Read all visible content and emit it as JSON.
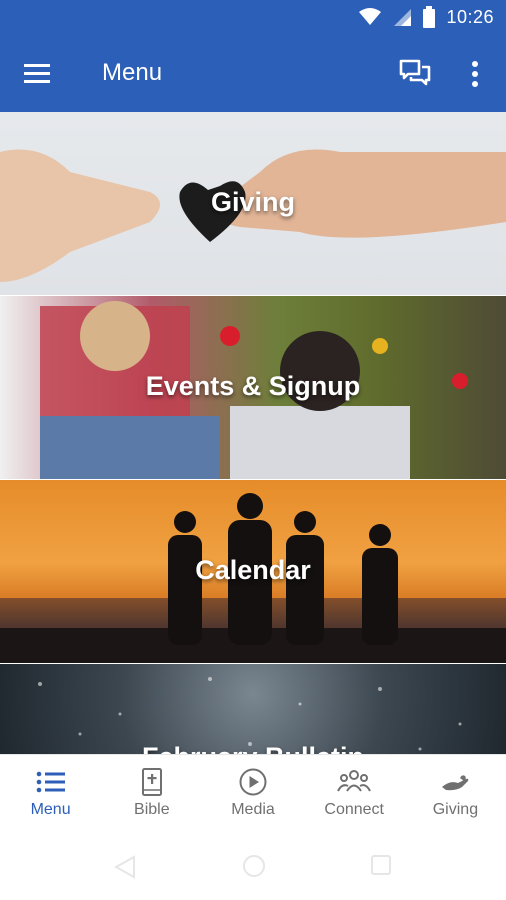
{
  "status_bar": {
    "time": "10:26"
  },
  "app_bar": {
    "title": "Menu"
  },
  "tiles": [
    {
      "label": "Giving"
    },
    {
      "label": "Events & Signup"
    },
    {
      "label": "Calendar"
    },
    {
      "label": "February Bulletin"
    }
  ],
  "bottom_nav": {
    "items": [
      {
        "label": "Menu",
        "icon": "list-icon",
        "active": true
      },
      {
        "label": "Bible",
        "icon": "bible-icon",
        "active": false
      },
      {
        "label": "Media",
        "icon": "play-icon",
        "active": false
      },
      {
        "label": "Connect",
        "icon": "people-icon",
        "active": false
      },
      {
        "label": "Giving",
        "icon": "giving-hand-icon",
        "active": false
      }
    ]
  },
  "colors": {
    "primary": "#2c5fb8",
    "nav_inactive": "#707070"
  }
}
